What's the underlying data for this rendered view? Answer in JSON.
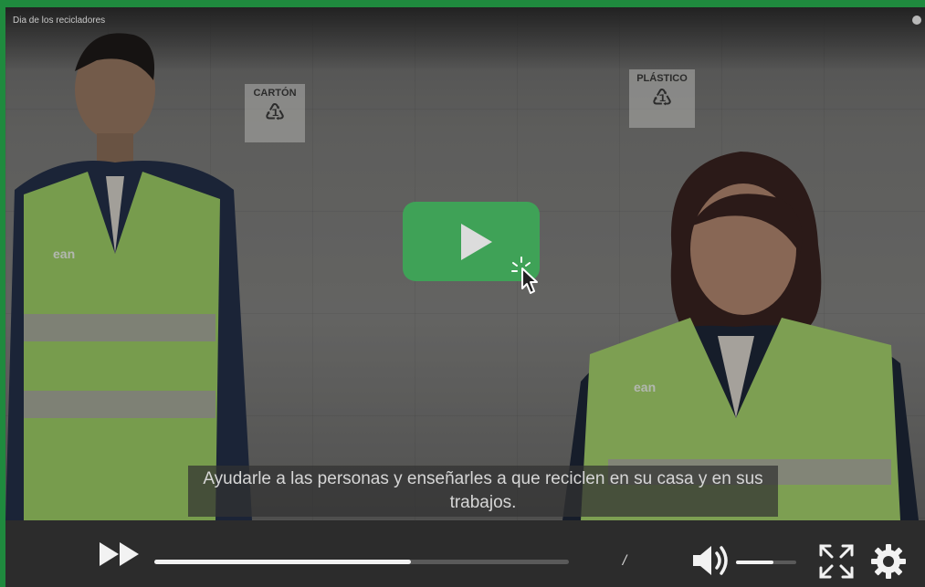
{
  "video": {
    "title": "Dia de los recicladores",
    "subtitle": "Ayudarle a las personas y enseñarles a que reciclen en su casa y en sus trabajos.",
    "signs": [
      {
        "label": "CARTÓN",
        "symbol": "♳"
      },
      {
        "label": "PLÁSTICO",
        "symbol": "♳"
      }
    ],
    "vest_brand": "ean"
  },
  "controls": {
    "time_separator": "/",
    "progress": 0.62,
    "volume": 0.62
  },
  "colors": {
    "accent": "#3fa257",
    "border": "#1f8a3e",
    "bar": "#2c2c2c"
  },
  "icons": {
    "play": "play-icon",
    "fast_forward": "fast-forward-icon",
    "volume": "volume-icon",
    "fullscreen": "fullscreen-icon",
    "settings": "gear-icon",
    "cursor": "hand-pointer-icon"
  }
}
